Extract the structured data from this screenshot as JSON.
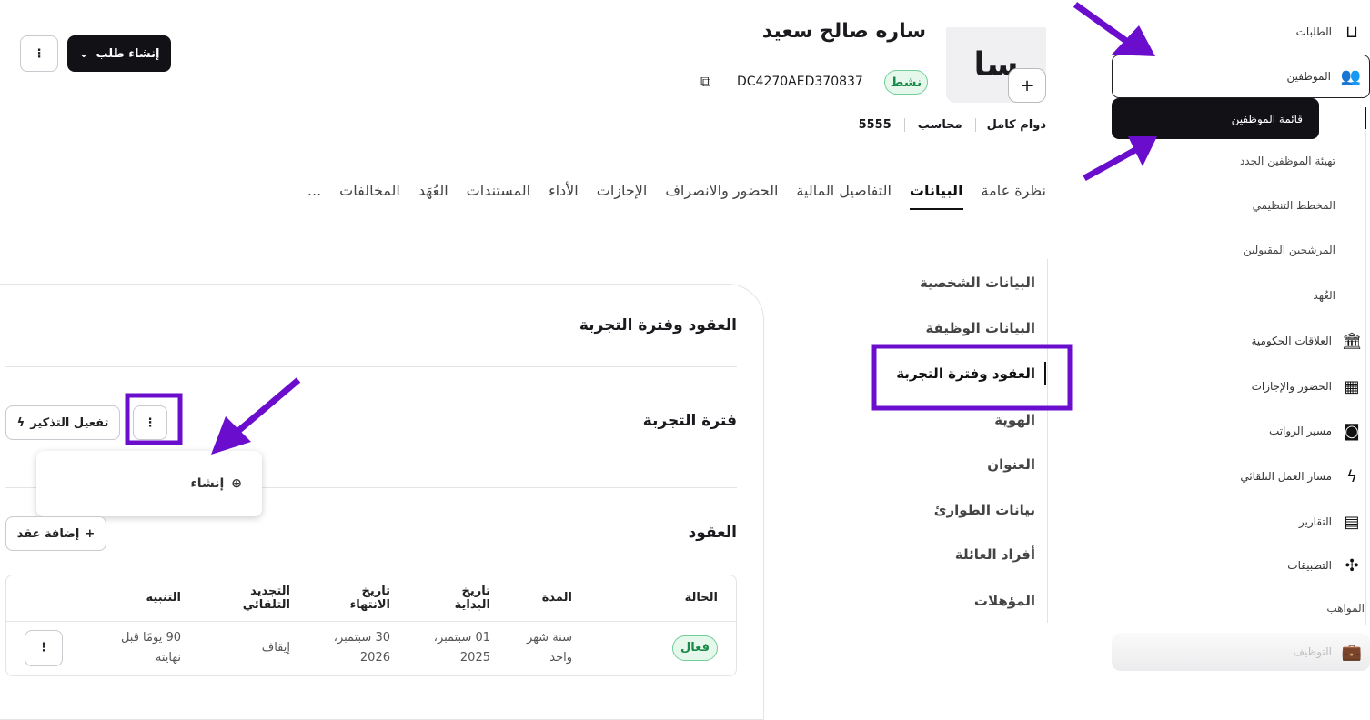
{
  "sidebar": {
    "requests": "الطلبات",
    "employees": "الموظفين",
    "sub": [
      "قائمة الموظفين",
      "تهيئة الموظفين الجدد",
      "المخطط التنظيمي",
      "المرشحين المقبولين",
      "العُهد"
    ],
    "items": [
      "العلاقات الحكومية",
      "الحضور والإجازات",
      "مسير الرواتب",
      "مسار العمل التلقائي",
      "التقارير",
      "التطبيقات"
    ],
    "talents": "المواهب",
    "recruitment": "التوظيف"
  },
  "header": {
    "avatar_initials": "سا",
    "name": "ساره صالح سعيد",
    "status": "نشط",
    "employee_id": "DC4270AED370837",
    "meta": [
      "دوام كامل",
      "محاسب",
      "5555"
    ],
    "create_request": "إنشاء طلب"
  },
  "tabs": [
    "نظرة عامة",
    "البيانات",
    "التفاصيل المالية",
    "الحضور والانصراف",
    "الإجازات",
    "الأداء",
    "المستندات",
    "العُهَد",
    "المخالفات",
    "..."
  ],
  "subnav": [
    "البيانات الشخصية",
    "البيانات الوظيفة",
    "العقود وفترة التجربة",
    "الهوية",
    "العنوان",
    "بيانات الطوارئ",
    "أفراد العائلة",
    "المؤهلات"
  ],
  "card": {
    "title": "العقود وفترة التجربة",
    "probation_title": "فترة التجربة",
    "enable_reminder": "تفعيل التذكير",
    "dropdown_create": "إنشاء",
    "contracts_title": "العقود",
    "add_contract": "إضافة عقد",
    "table": {
      "headers": [
        "الحالة",
        "المدة",
        "تاريخ البداية",
        "تاريخ الانتهاء",
        "التجديد التلقائي",
        "التنبيه"
      ],
      "rows": [
        [
          "فعال",
          "سنة شهر واحد",
          "01 سبتمبر، 2025",
          "30 سبتمبر، 2026",
          "إيقاف",
          "90 يومًا قبل نهايته"
        ]
      ]
    }
  },
  "colors": {
    "accent": "#6a0dcc",
    "active_bg": "#111116",
    "success": "#1a8a4a"
  }
}
